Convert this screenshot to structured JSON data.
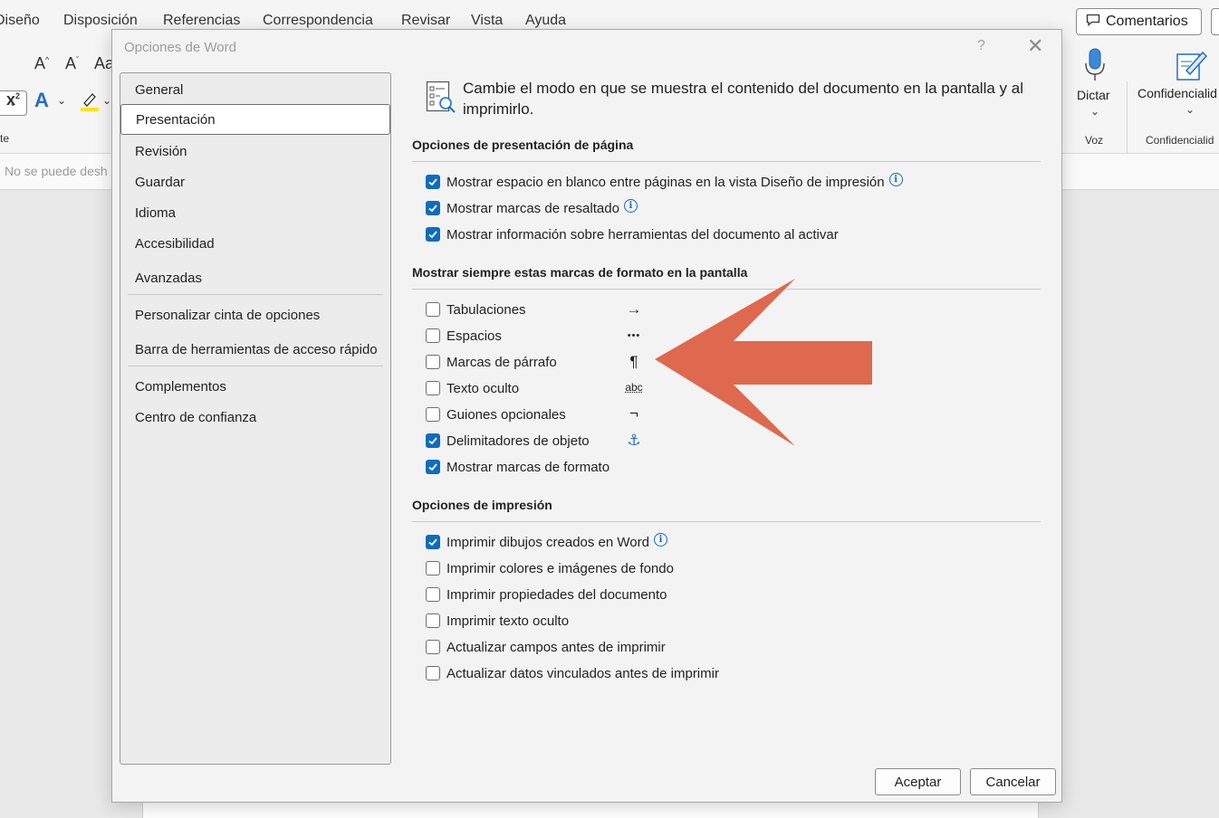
{
  "word": {
    "menu": [
      "Diseño",
      "Disposición",
      "Referencias",
      "Correspondencia",
      "Revisar",
      "Vista",
      "Ayuda"
    ],
    "comments_label": "Comentarios",
    "ribbon": {
      "dictate_label": "Dictar",
      "voice_group": "Voz",
      "sensitivity_label": "Confidencialid",
      "sensitivity_group": "Confidencialid",
      "partial_label": "te"
    },
    "message_bar_text": "No se puede desh"
  },
  "dialog": {
    "title": "Opciones de Word",
    "help": "?",
    "close": "✕",
    "nav": {
      "items": [
        "General",
        "Presentación",
        "Revisión",
        "Guardar",
        "Idioma",
        "Accesibilidad",
        "Avanzadas",
        "Personalizar cinta de opciones",
        "Barra de herramientas de acceso rápido",
        "Complementos",
        "Centro de confianza"
      ],
      "selected": "Presentación"
    },
    "intro": "Cambie el modo en que se muestra el contenido del documento en la pantalla y al imprimirlo.",
    "sections": {
      "page_display": {
        "heading": "Opciones de presentación de página",
        "options": [
          {
            "label": "Mostrar espacio en blanco entre páginas en la vista Diseño de impresión",
            "checked": true,
            "info": true
          },
          {
            "label": "Mostrar marcas de resaltado",
            "checked": true,
            "info": true
          },
          {
            "label": "Mostrar información sobre herramientas del documento al activar",
            "checked": true,
            "info": false
          }
        ]
      },
      "formatting_marks": {
        "heading": "Mostrar siempre estas marcas de formato en la pantalla",
        "options": [
          {
            "label": "Tabulaciones",
            "checked": false,
            "symbol": "→"
          },
          {
            "label": "Espacios",
            "checked": false,
            "symbol": "•••"
          },
          {
            "label": "Marcas de párrafo",
            "checked": false,
            "symbol": "¶"
          },
          {
            "label": "Texto oculto",
            "checked": false,
            "symbol": "abc"
          },
          {
            "label": "Guiones opcionales",
            "checked": false,
            "symbol": "¬"
          },
          {
            "label": "Delimitadores de objeto",
            "checked": true,
            "symbol": "⚓"
          },
          {
            "label": "Mostrar marcas de formato",
            "checked": true
          }
        ]
      },
      "print": {
        "heading": "Opciones de impresión",
        "options": [
          {
            "label": "Imprimir dibujos creados en Word",
            "checked": true,
            "info": true
          },
          {
            "label": "Imprimir colores e imágenes de fondo",
            "checked": false
          },
          {
            "label": "Imprimir propiedades del documento",
            "checked": false
          },
          {
            "label": "Imprimir texto oculto",
            "checked": false
          },
          {
            "label": "Actualizar campos antes de imprimir",
            "checked": false
          },
          {
            "label": "Actualizar datos vinculados antes de imprimir",
            "checked": false
          }
        ]
      }
    },
    "buttons": {
      "ok": "Aceptar",
      "cancel": "Cancelar"
    }
  },
  "colors": {
    "accent": "#0f6cbd",
    "annotation_arrow": "#dd6448"
  },
  "icons": [
    "comment-icon",
    "microphone-icon",
    "sensitivity-icon",
    "display-options-icon",
    "info-icon",
    "check-icon",
    "annotation-arrow"
  ]
}
